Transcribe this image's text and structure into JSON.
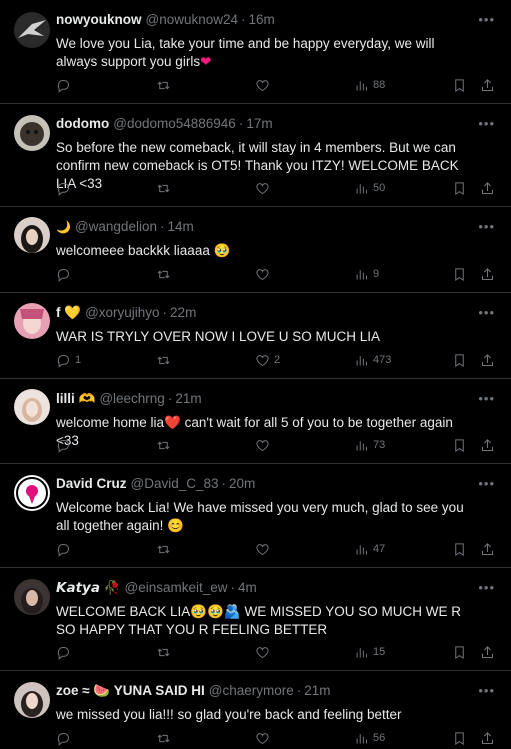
{
  "tweets": [
    {
      "name": "nowyouknow",
      "handle": "@nowuknow24",
      "time": "16m",
      "text": "We love you Lia, take your time and be happy everyday, we will always support you girls",
      "text_suffix": "❤",
      "replies": "",
      "retweets": "",
      "likes": "",
      "views": "88",
      "avatar_color": "#9aa0a6"
    },
    {
      "name": "dodomo",
      "handle": "@dodomo54886946",
      "time": "17m",
      "text": "So before the new comeback, it will stay in 4 members. But we can confirm new comeback is OT5! Thank you ITZY! WELCOME BACK LIA <33",
      "text_suffix": "",
      "replies": "",
      "retweets": "",
      "likes": "",
      "views": "50",
      "avatar_color": "#5b5146"
    },
    {
      "name": "🌙",
      "handle": "@wangdelion",
      "time": "14m",
      "text": "welcomeee backkk liaaaa 🥹",
      "text_suffix": "",
      "replies": "",
      "retweets": "",
      "likes": "",
      "views": "9",
      "avatar_color": "#c9b8ac"
    },
    {
      "name": "f 💛",
      "handle": "@xoryujihyo",
      "time": "22m",
      "text": "WAR IS TRYLY OVER NOW I LOVE U SO MUCH LIA",
      "text_suffix": "",
      "replies": "1",
      "retweets": "",
      "likes": "2",
      "views": "473",
      "avatar_color": "#e8a7b8"
    },
    {
      "name": "lilli 🫶",
      "handle": "@leechrng",
      "time": "21m",
      "text": "welcome home lia❤️ can't wait for all 5 of you to be together again <33",
      "text_suffix": "",
      "replies": "",
      "retweets": "",
      "likes": "",
      "views": "73",
      "avatar_color": "#e4d6cf"
    },
    {
      "name": "David Cruz",
      "handle": "@David_C_83",
      "time": "20m",
      "text": "Welcome back Lia! We have missed you very much, glad to see you all together again! 😊",
      "text_suffix": "",
      "replies": "",
      "retweets": "",
      "likes": "",
      "views": "47",
      "avatar_color": "#ffffff"
    },
    {
      "name": "𝙆𝙖𝙩𝙮𝙖 🥀",
      "handle": "@einsamkeit_ew",
      "time": "4m",
      "text": "WELCOME BACK LIA🥹🥹🫂 WE MISSED YOU SO MUCH WE R SO HAPPY THAT YOU R FEELING BETTER",
      "text_suffix": "",
      "replies": "",
      "retweets": "",
      "likes": "",
      "views": "15",
      "avatar_color": "#7d6f6a"
    },
    {
      "name": "zoe ≈ 🍉 YUNA SAID HI",
      "handle": "@chaerymore",
      "time": "21m",
      "text": "we missed you lia!!! so glad you're back and feeling better",
      "text_suffix": "",
      "replies": "",
      "retweets": "",
      "likes": "",
      "views": "56",
      "avatar_color": "#cfc6c3"
    }
  ],
  "icons": {
    "reply": "reply-icon",
    "retweet": "retweet-icon",
    "like": "heart-icon",
    "views": "views-icon",
    "bookmark": "bookmark-icon",
    "share": "share-icon",
    "more": "more-icon"
  },
  "colors": {
    "background": "#000000",
    "text": "#e7e9ea",
    "muted": "#71767b",
    "divider": "#2f3336",
    "heart": "#f91880"
  }
}
